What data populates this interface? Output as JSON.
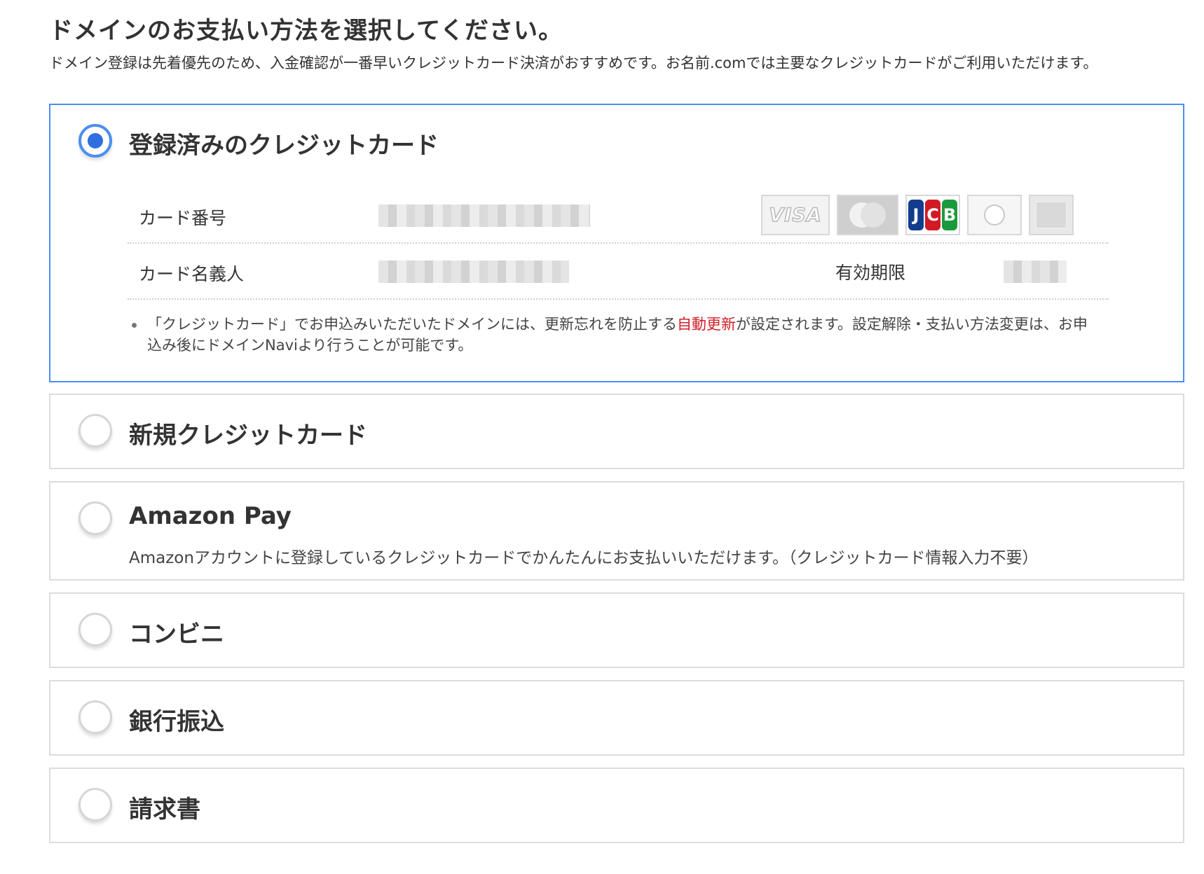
{
  "header": {
    "title": "ドメインのお支払い方法を選択してください。",
    "lead": "ドメイン登録は先着優先のため、入金確認が一番早いクレジットカード決済がおすすめです。お名前.comでは主要なクレジットカードがご利用いただけます。"
  },
  "options": {
    "registered_card": {
      "label": "登録済みのクレジットカード",
      "selected": true,
      "card_number_label": "カード番号",
      "card_holder_label": "カード名義人",
      "expiry_label": "有効期限",
      "brands": [
        "visa-logo",
        "mastercard-logo",
        "jcb-logo",
        "diners-club-logo",
        "amex-logo"
      ],
      "brand_visa_text": "VISA",
      "note_part1": "「クレジットカード」でお申込みいただいたドメインには、更新忘れを防止する",
      "note_link": "自動更新",
      "note_part2": "が設定されます。設定解除・支払い方法変更は、お申込み後にドメインNaviより行うことが可能です。"
    },
    "new_card": {
      "label": "新規クレジットカード",
      "selected": false
    },
    "amazon_pay": {
      "label": "Amazon Pay",
      "selected": false,
      "description": "Amazonアカウントに登録しているクレジットカードでかんたんにお支払いいただけます。（クレジットカード情報入力不要）"
    },
    "convenience_store": {
      "label": "コンビニ",
      "selected": false
    },
    "bank_transfer": {
      "label": "銀行振込",
      "selected": false
    },
    "invoice": {
      "label": "請求書",
      "selected": false
    }
  },
  "colors": {
    "accent": "#4a8ef2",
    "radio_dot": "#2f6fe0",
    "link_red": "#d0202a",
    "border": "#dcdcdc"
  }
}
